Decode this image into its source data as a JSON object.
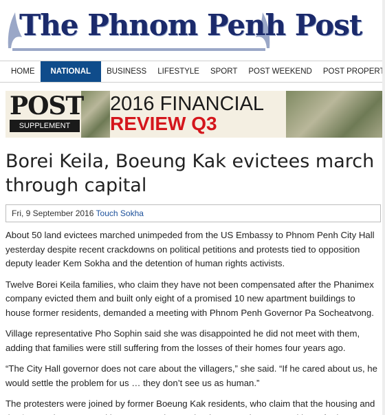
{
  "site": {
    "title": "The Phnom Penh Post"
  },
  "nav": {
    "items": [
      {
        "label": "HOME",
        "active": false
      },
      {
        "label": "NATIONAL",
        "active": true
      },
      {
        "label": "BUSINESS",
        "active": false
      },
      {
        "label": "LIFESTYLE",
        "active": false
      },
      {
        "label": "SPORT",
        "active": false
      },
      {
        "label": "POST WEEKEND",
        "active": false
      },
      {
        "label": "POST PROPERTY",
        "active": false
      }
    ],
    "active_color": "#0f4c8b"
  },
  "banner": {
    "brand": "POST",
    "badge": "SUPPLEMENT",
    "line1": "2016 FINANCIAL",
    "line2": "REVIEW Q3",
    "accent_color": "#d4161c"
  },
  "article": {
    "headline": "Borei Keila, Boeung Kak evictees march through capital",
    "date": "Fri, 9 September 2016",
    "author": "Touch Sokha",
    "paragraphs": [
      "About 50 land evictees marched unimpeded from the US Embassy to Phnom Penh City Hall yesterday despite recent crackdowns on political petitions and protests tied to opposition deputy leader Kem Sokha and the detention of human rights activists.",
      "Twelve Borei Keila families, who claim they have not been compensated after the Phanimex company evicted them and built only eight of a promised 10 new apartment buildings to house former residents, demanded a meeting with Phnom Penh Governor Pa Socheatvong.",
      "Village representative Pho Sophin said she was disappointed he did not meet with them, adding that families were still suffering from the losses of their homes four years ago.",
      "“The City Hall governor does not care about the villagers,” she said. “If he cared about us, he would settle the problem for us … they don’t see us as human.”",
      "The protesters were joined by former Boeung Kak residents, who claim that the housing and the $8,500 they accepted in compensation are inadequate. They are seeking a further"
    ]
  }
}
